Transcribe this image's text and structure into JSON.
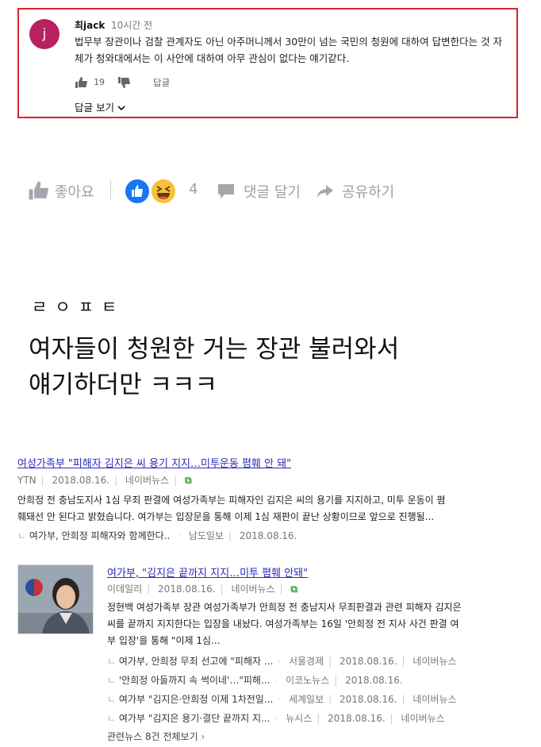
{
  "comment": {
    "avatar_letter": "j",
    "author": "최jack",
    "time": "10시간 전",
    "text": "법무부 장관이나 검찰 관계자도 아닌 아주머니께서 30만이 넘는 국민의 청원에 대하여 답변한다는 것 자체가 청와대에서는 이 사안에 대하여 아무 관심이 없다는 얘기같다.",
    "likes": "19",
    "reply_label": "답글",
    "view_replies": "답글 보기",
    "border_color": "#d9252b",
    "avatar_color": "#b8205f"
  },
  "fb_bar": {
    "like_label": "좋아요",
    "reaction_count": "4",
    "comment_label": "댓글 달기",
    "share_label": "공유하기"
  },
  "caption": {
    "small": "ㄹㅇㅍㅌ",
    "line1": "여자들이 청원한 거는 장관 불러와서",
    "line2": "얘기하더만 ㅋㅋㅋ"
  },
  "news": [
    {
      "title": "여성가족부 \"피해자 김지은 씨 용기 지지…미투운동 폄훼 안 돼\"",
      "source": "YTN",
      "date": "2018.08.16.",
      "portal": "네이버뉴스",
      "body1": "안희정 전 충남도지사 1심 무죄 판결에 여성가족부는 피해자인 김지은 씨의 용기를 지지하고, 미투 운동이 폄",
      "body2": "훼돼선 안 된다고 밝혔습니다. 여가부는 입장문을 통해 이제 1심 재판이 끝난 상황이므로 앞으로 진행될...",
      "related": {
        "title": "여가부, 안희정 피해자와 함께한다..",
        "source": "남도일보",
        "date": "2018.08.16."
      }
    },
    {
      "title": "여가부, \"김지은 끝까지 지지…미투 폄훼 안돼\"",
      "source": "이데일리",
      "date": "2018.08.16.",
      "portal": "네이버뉴스",
      "body1": "정현백 여성가족부 장관 여성가족부가 안희정 전 충남지사 무죄판결과 관련 피해자 김지은",
      "body2": "씨를 끝까지 지지한다는 입장을 내놨다. 여성가족부는 16일 '안희정 전 지사 사건 판결 여",
      "body3": "부 입장'을 통해 \"이제 1심...",
      "related": [
        {
          "title": "여가부, 안희정 무죄 선고에 \"피해자 ...",
          "source": "서울경제",
          "date": "2018.08.16.",
          "portal": "네이버뉴스"
        },
        {
          "title": "'안희정 아들까지 속 썩이네'…\"피해...",
          "source": "이코노뉴스",
          "date": "2018.08.16.",
          "portal": ""
        },
        {
          "title": "여가부 \"김지은·안희정 이제 1차전일...",
          "source": "세계일보",
          "date": "2018.08.16.",
          "portal": "네이버뉴스"
        },
        {
          "title": "여가부 \"김지은 용기·결단 끝까지 지...",
          "source": "뉴시스",
          "date": "2018.08.16.",
          "portal": "네이버뉴스"
        }
      ],
      "more": "관련뉴스 8건 전체보기"
    }
  ]
}
